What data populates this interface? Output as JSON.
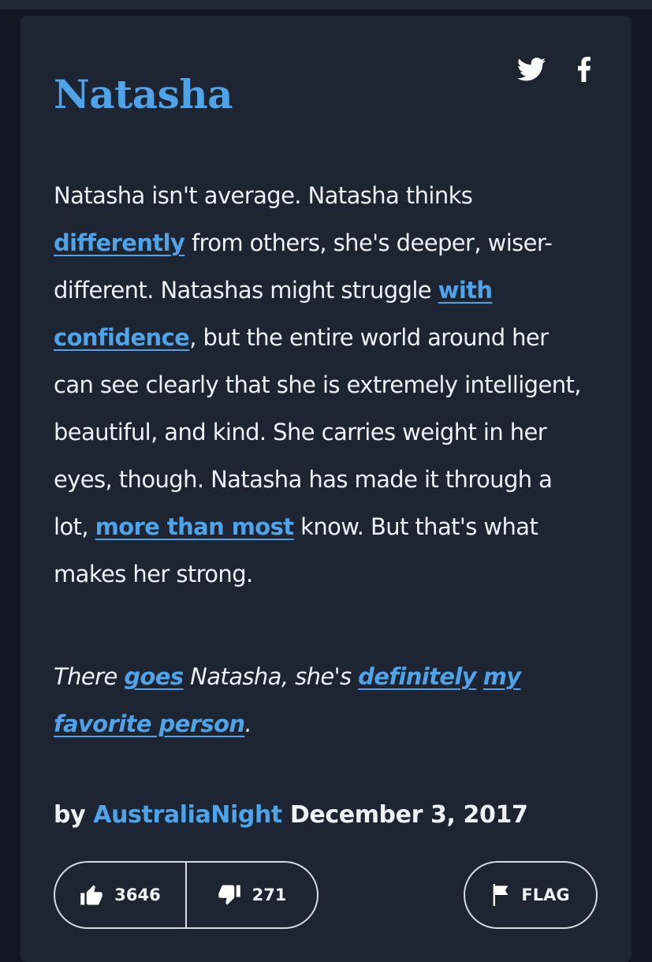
{
  "entry": {
    "word": "Natasha",
    "definition": [
      {
        "text": "Natasha isn't average. Natasha thinks "
      },
      {
        "text": "differently",
        "link": true
      },
      {
        "text": " from others, she's deeper, wiser- different. Natashas might struggle "
      },
      {
        "text": "with confidence",
        "link": true
      },
      {
        "text": ", but the entire world around her can see clearly that she is extremely intelligent, beautiful, and kind. She carries weight in her eyes, though. Natasha has made it through a lot, "
      },
      {
        "text": "more than most",
        "link": true
      },
      {
        "text": " know. But that's what makes her strong."
      }
    ],
    "example": [
      {
        "text": "There "
      },
      {
        "text": "goes",
        "link": true
      },
      {
        "text": " Natasha, she's "
      },
      {
        "text": "definitely",
        "link": true
      },
      {
        "text": " "
      },
      {
        "text": "my",
        "link": true
      },
      {
        "text": " "
      },
      {
        "text": "favorite person",
        "link": true
      },
      {
        "text": "."
      }
    ],
    "by_label": "by",
    "author": "AustraliaNight",
    "date": "December 3, 2017",
    "upvotes": "3646",
    "downvotes": "271",
    "flag_label": "FLAG"
  },
  "share": {
    "twitter_icon": "twitter-icon",
    "facebook_icon": "facebook-icon"
  },
  "colors": {
    "background": "#131722",
    "card": "#1d2432",
    "accent": "#4fa3e8",
    "text": "#eef1f5"
  }
}
